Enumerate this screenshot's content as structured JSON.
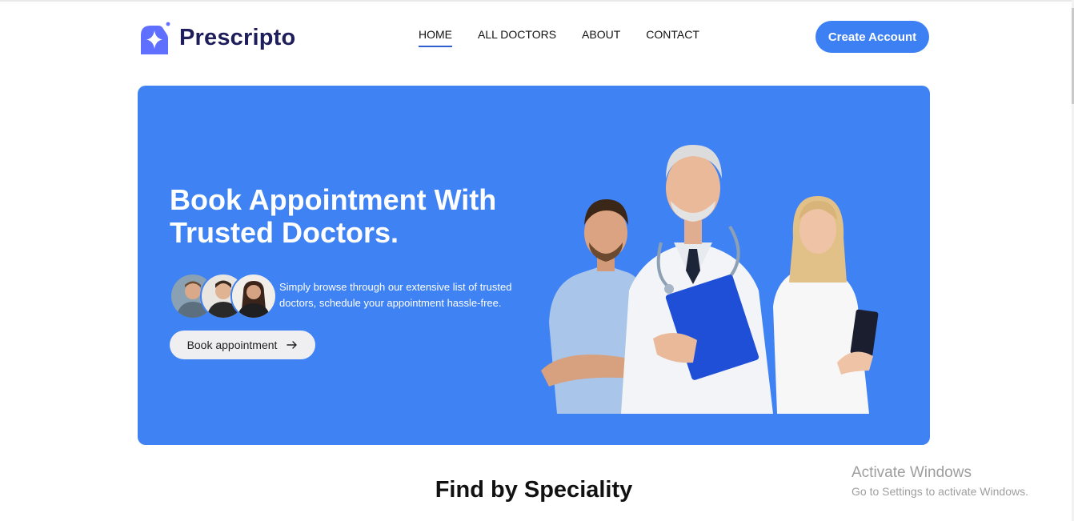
{
  "brand": {
    "name": "Prescripto"
  },
  "nav": [
    {
      "label": "HOME",
      "active": true
    },
    {
      "label": "ALL DOCTORS",
      "active": false
    },
    {
      "label": "ABOUT",
      "active": false
    },
    {
      "label": "CONTACT",
      "active": false
    }
  ],
  "header": {
    "create_account_label": "Create Account"
  },
  "hero": {
    "title": "Book Appointment With Trusted Doctors.",
    "description": "Simply browse through our extensive list of trusted doctors, schedule your appointment hassle-free.",
    "book_label": "Book appointment",
    "book_icon": "arrow-right-icon"
  },
  "speciality": {
    "title": "Find by Speciality"
  },
  "watermark": {
    "line1": "Activate Windows",
    "line2": "Go to Settings to activate Windows."
  },
  "colors": {
    "primary": "#3d80f3",
    "hero_bg": "#3f82f3",
    "brand_text": "#1f1e5c",
    "nav_underline": "#2f5fd0"
  }
}
